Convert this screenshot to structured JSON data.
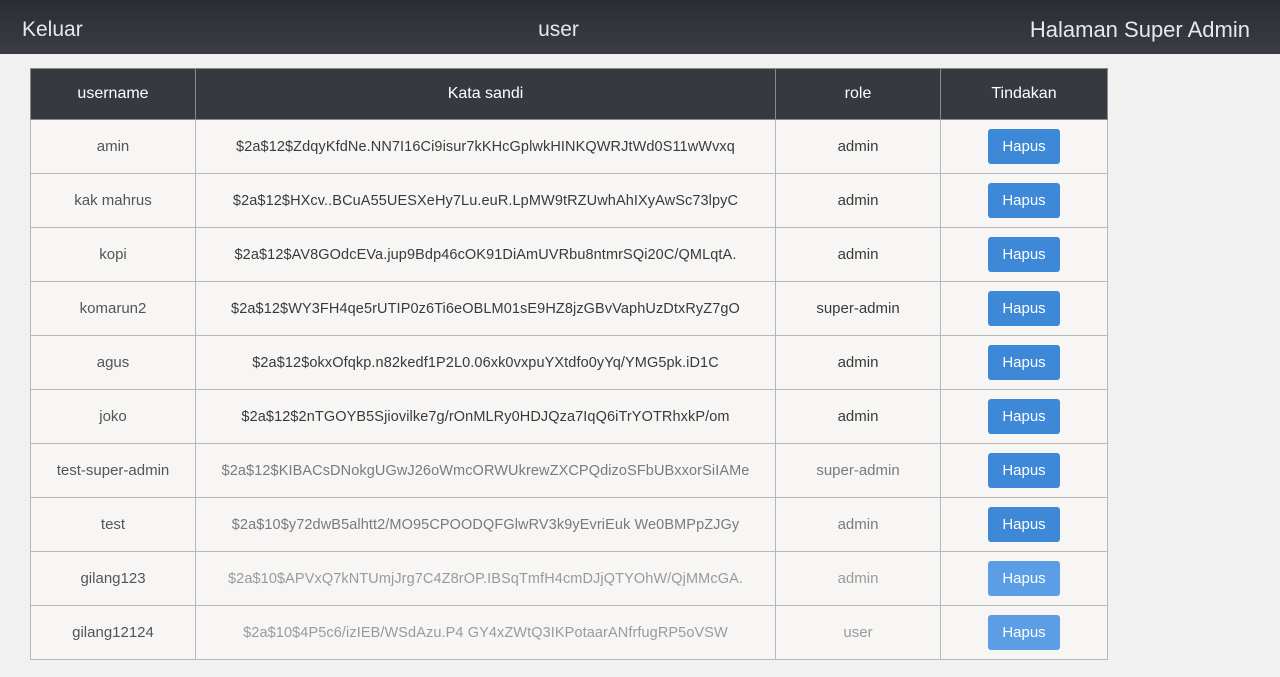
{
  "header": {
    "logout_label": "Keluar",
    "title": "user",
    "page_label": "Halaman Super Admin"
  },
  "table": {
    "columns": [
      "username",
      "Kata sandi",
      "role",
      "Tindakan"
    ],
    "rows": [
      {
        "username": "amin",
        "password": "$2a$12$ZdqyKfdNe.NN7I16Ci9isur7kKHcGplwkHINKQWRJtWd0S11wWvxq",
        "role": "admin",
        "action": "Hapus"
      },
      {
        "username": "kak mahrus",
        "password": "$2a$12$HXcv..BCuA55UESXeHy7Lu.euR.LpMW9tRZUwhAhIXyAwSc73lpyC",
        "role": "admin",
        "action": "Hapus"
      },
      {
        "username": "kopi",
        "password": "$2a$12$AV8GOdcEVa.jup9Bdp46cOK91DiAmUVRbu8ntmrSQi20C/QMLqtA.",
        "role": "admin",
        "action": "Hapus"
      },
      {
        "username": "komarun2",
        "password": "$2a$12$WY3FH4qe5rUTIP0z6Ti6eOBLM01sE9HZ8jzGBvVaphUzDtxRyZ7gO",
        "role": "super-admin",
        "action": "Hapus"
      },
      {
        "username": "agus",
        "password": "$2a$12$okxOfqkp.n82kedf1P2L0.06xk0vxpuYXtdfo0yYq/YMG5pk.iD1C",
        "role": "admin",
        "action": "Hapus"
      },
      {
        "username": "joko",
        "password": "$2a$12$2nTGOYB5Sjiovilke7g/rOnMLRy0HDJQza7IqQ6iTrYOTRhxkP/om",
        "role": "admin",
        "action": "Hapus"
      },
      {
        "username": "test-super-admin",
        "password": "$2a$12$KIBACsDNokgUGwJ26oWmcORWUkrewZXCPQdizoSFbUBxxorSiIAMe",
        "role": "super-admin",
        "action": "Hapus"
      },
      {
        "username": "test",
        "password": "$2a$10$y72dwB5alhtt2/MO95CPOODQFGlwRV3k9yEvriEuk We0BMPpZJGy",
        "role": "admin",
        "action": "Hapus"
      },
      {
        "username": "gilang123",
        "password": "$2a$10$APVxQ7kNTUmjJrg7C4Z8rOP.IBSqTmfH4cmDJjQTYOhW/QjMMcGA.",
        "role": "admin",
        "action": "Hapus"
      },
      {
        "username": "gilang12124",
        "password": "$2a$10$4P5c6/izIEB/WSdAzu.P4 GY4xZWtQ3IKPotaarANfrfugRP5oVSW",
        "role": "user",
        "action": "Hapus"
      }
    ]
  }
}
